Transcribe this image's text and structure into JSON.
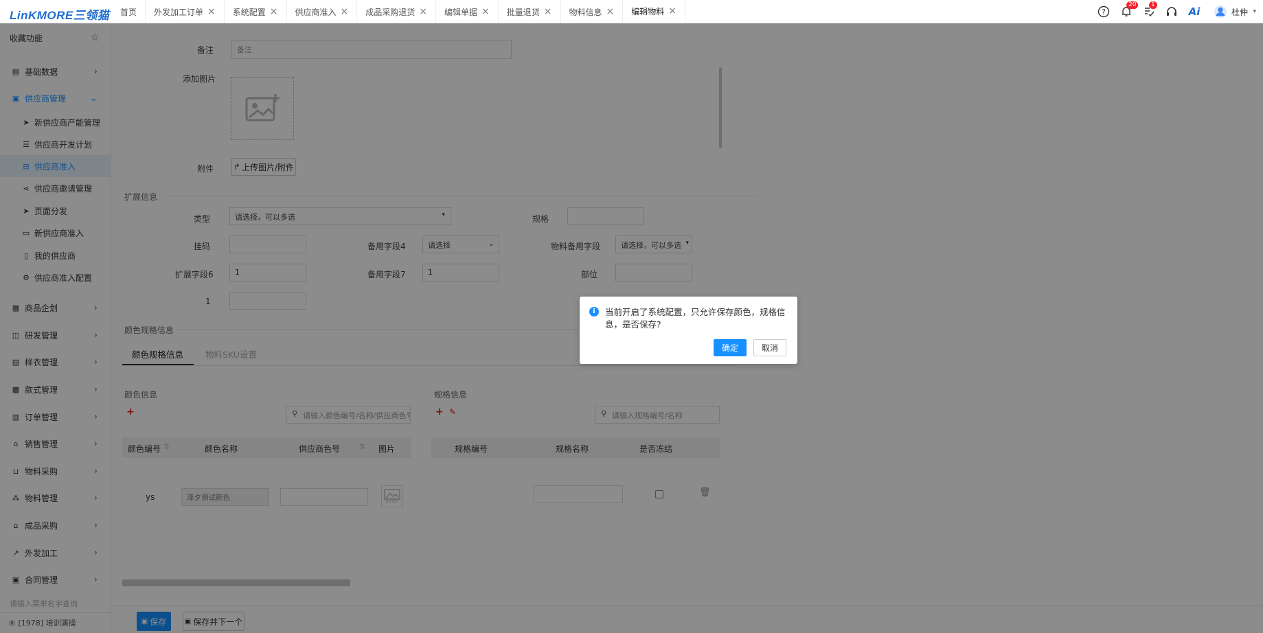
{
  "app": {
    "logo": "LinKMORE三领猫"
  },
  "tabs": [
    {
      "label": "首页",
      "closable": false
    },
    {
      "label": "外发加工订单",
      "closable": true
    },
    {
      "label": "系统配置",
      "closable": true
    },
    {
      "label": "供应商准入",
      "closable": true
    },
    {
      "label": "成品采购退货",
      "closable": true
    },
    {
      "label": "编辑单据",
      "closable": true
    },
    {
      "label": "批量退货",
      "closable": true
    },
    {
      "label": "物料信息",
      "closable": true
    },
    {
      "label": "编辑物料",
      "closable": true,
      "active": true
    }
  ],
  "header": {
    "notification_count": "20",
    "task_count": "1",
    "ai_label": "Ai",
    "username": "杜仲"
  },
  "sidebar": {
    "favorites": "收藏功能",
    "items": [
      {
        "label": "基础数据",
        "icon": "book-icon"
      },
      {
        "label": "供应商管理",
        "icon": "supplier-icon",
        "expanded": true
      },
      {
        "label": "商品企划",
        "icon": "calendar-icon"
      },
      {
        "label": "研发管理",
        "icon": "dev-icon"
      },
      {
        "label": "样衣管理",
        "icon": "id-card-icon"
      },
      {
        "label": "款式管理",
        "icon": "style-icon"
      },
      {
        "label": "订单管理",
        "icon": "order-icon"
      },
      {
        "label": "销售管理",
        "icon": "bank-icon"
      },
      {
        "label": "物料采购",
        "icon": "basket-icon"
      },
      {
        "label": "物料管理",
        "icon": "cubes-icon"
      },
      {
        "label": "成品采购",
        "icon": "bank-icon"
      },
      {
        "label": "外发加工",
        "icon": "external-link-icon"
      },
      {
        "label": "合同管理",
        "icon": "contract-icon"
      }
    ],
    "subitems": [
      {
        "label": "新供应商产能管理",
        "icon": "send-icon"
      },
      {
        "label": "供应商开发计划",
        "icon": "list-icon"
      },
      {
        "label": "供应商准入",
        "icon": "inbox-icon",
        "active": true
      },
      {
        "label": "供应商邀请管理",
        "icon": "share-icon"
      },
      {
        "label": "页面分发",
        "icon": "send-icon"
      },
      {
        "label": "新供应商准入",
        "icon": "folder-icon"
      },
      {
        "label": "我的供应商",
        "icon": "file-icon"
      },
      {
        "label": "供应商准入配置",
        "icon": "cogs-icon"
      }
    ],
    "search_placeholder": "请输入菜单名字查询",
    "footer": "® [1978] 培训演操"
  },
  "form": {
    "remark_label": "备注",
    "remark_placeholder": "备注",
    "add_image_label": "添加图片",
    "attachment_label": "附件",
    "upload_button": "上传图片/附件",
    "ext_section": "扩展信息",
    "type_label": "类型",
    "type_placeholder": "请选择，可以多选",
    "spec_label": "规格",
    "spec_value": "",
    "hanging_code_label": "挂码",
    "hanging_code_value": "",
    "spare4_label": "备用字段4",
    "spare4_placeholder": "请选择",
    "material_spare_label": "物料备用字段",
    "material_spare_placeholder": "请选择，可以多选",
    "ext6_label": "扩展字段6",
    "ext6_value": "1",
    "spare7_label": "备用字段7",
    "spare7_value": "1",
    "part_label": "部位",
    "part_value": "",
    "one_label": "1",
    "one_value": ""
  },
  "color_spec": {
    "section": "颜色规格信息",
    "tab_active": "颜色规格信息",
    "tab_inactive": "物料SKU设置",
    "hidden_button": "",
    "color_title": "颜色信息",
    "color_search_placeholder": "请输入颜色编号/名称/供应商色号",
    "color_headers": [
      "颜色编号",
      "颜色名称",
      "供应商色号",
      "图片"
    ],
    "color_rows": [
      {
        "code": "ys",
        "name": "泽夕测试颜色",
        "supplier_code": ""
      }
    ],
    "image_placeholder": "暂无图片",
    "spec_title": "规格信息",
    "spec_search_placeholder": "请输入规格编号/名称",
    "spec_headers": [
      "规格编号",
      "规格名称",
      "是否冻结"
    ]
  },
  "footer_buttons": {
    "save": "保存",
    "save_next": "保存并下一个"
  },
  "dialog": {
    "message": "当前开启了系统配置，只允许保存颜色，规格信息，是否保存?",
    "confirm": "确定",
    "cancel": "取消"
  },
  "colors": {
    "primary": "#1890ff",
    "badge": "#f5222d",
    "active_bg": "#e6f2fd",
    "red_icon": "#e02020"
  }
}
